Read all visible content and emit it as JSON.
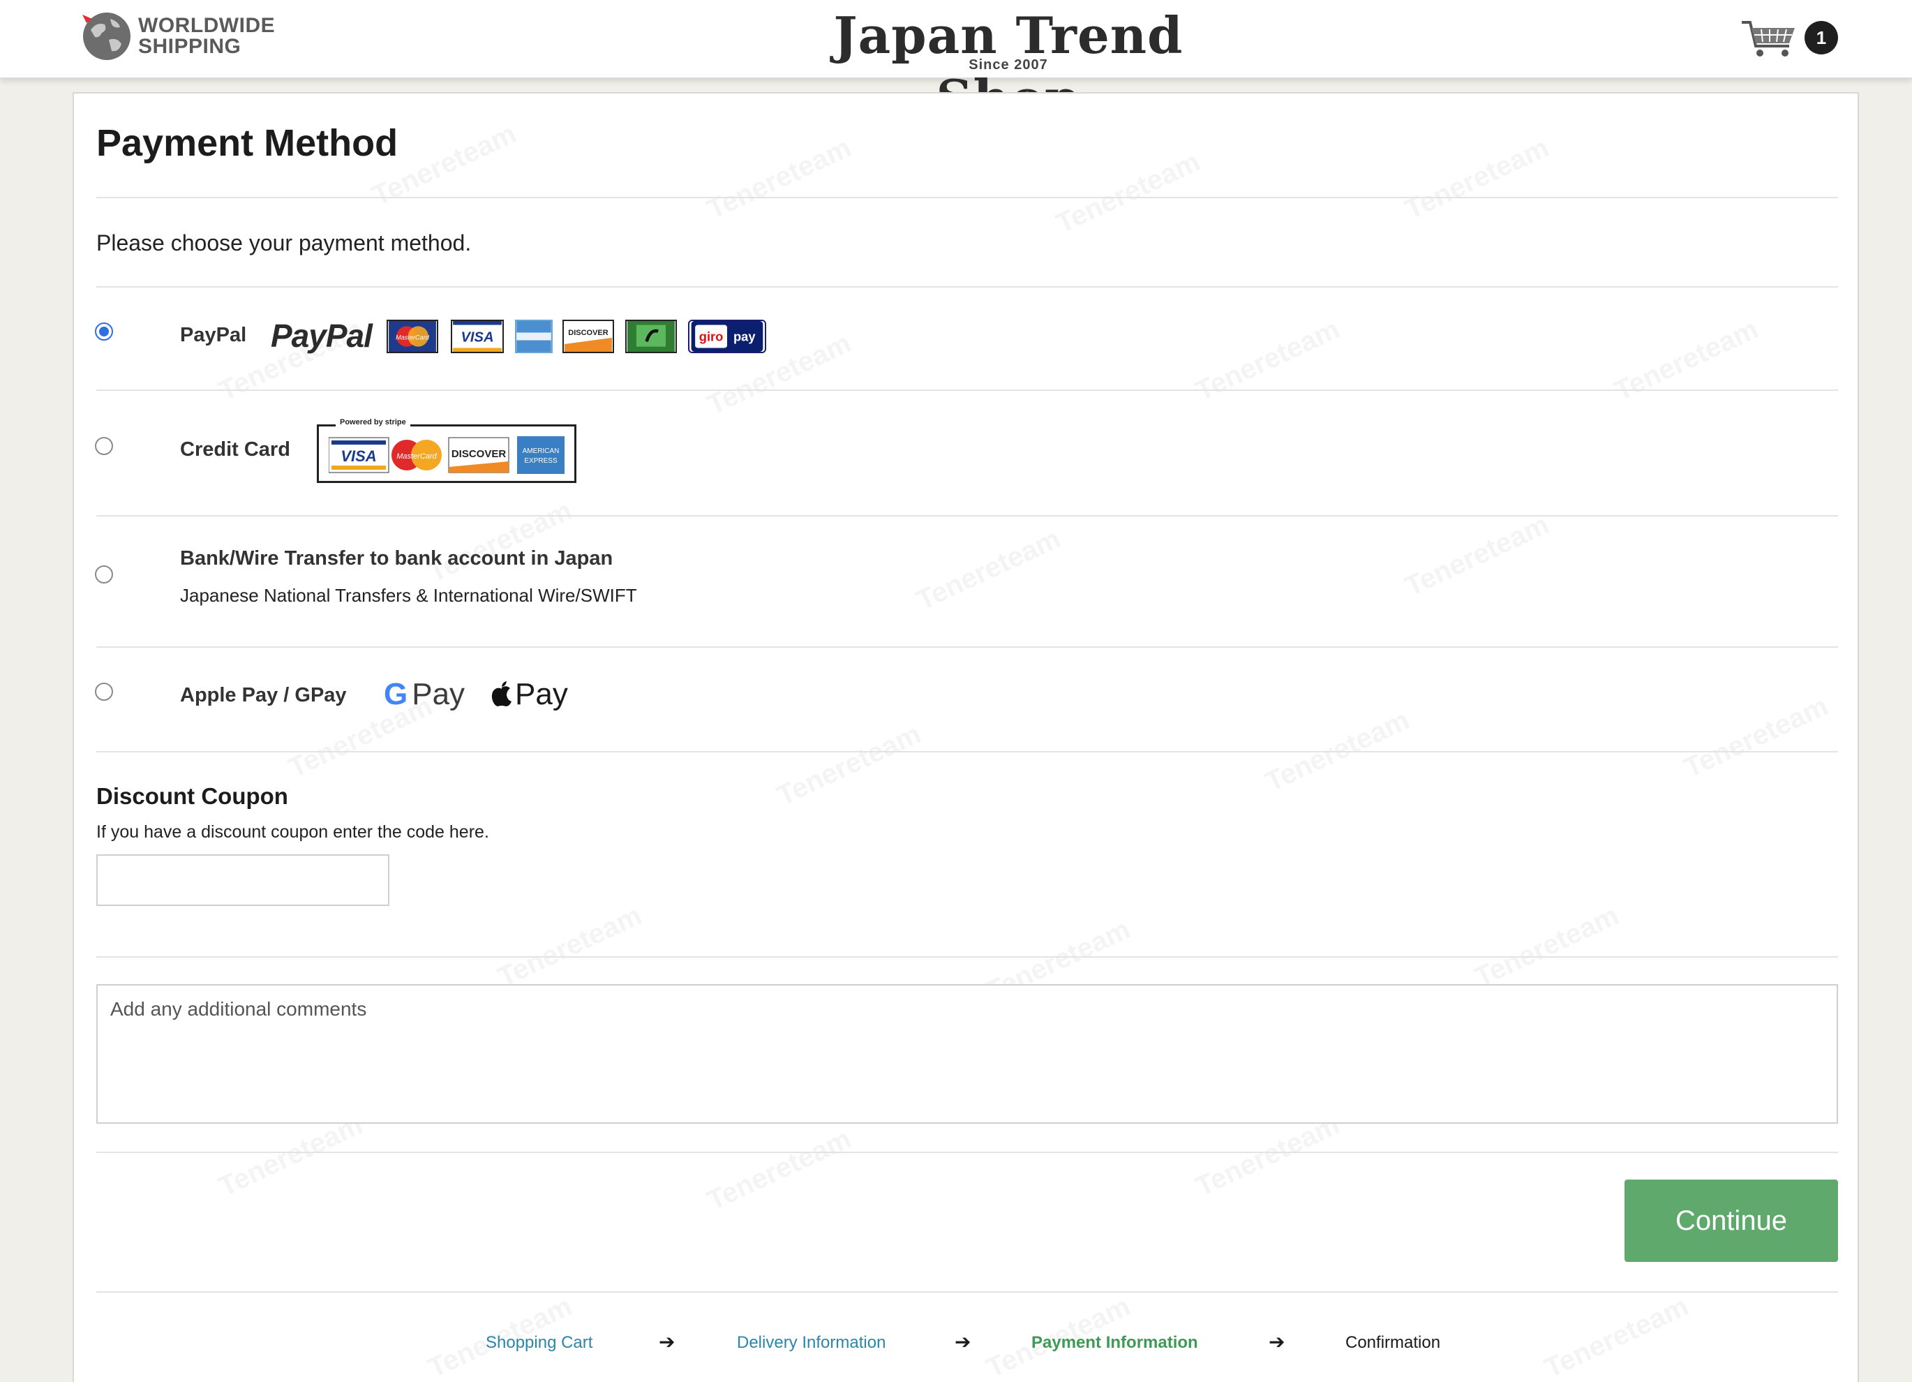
{
  "header": {
    "shipping_logo_line1": "WORLDWIDE",
    "shipping_logo_line2": "SHIPPING",
    "brand_title": "Japan Trend Shop",
    "brand_sub": "Since 2007",
    "cart_count": "1"
  },
  "page": {
    "title": "Payment Method",
    "intro": "Please choose your payment method."
  },
  "payment_options": [
    {
      "label": "PayPal",
      "selected": true,
      "logos": [
        "PayPal",
        "MasterCard",
        "VISA",
        "American Express",
        "DISCOVER",
        "giropay"
      ]
    },
    {
      "label": "Credit Card",
      "selected": false,
      "powered_by": "Powered by stripe",
      "logos": [
        "VISA",
        "MasterCard",
        "DISCOVER",
        "AMERICAN EXPRESS"
      ]
    },
    {
      "label": "Bank/Wire Transfer to bank account in Japan",
      "sub": "Japanese National Transfers & International Wire/SWIFT",
      "selected": false
    },
    {
      "label": "Apple Pay / GPay",
      "selected": false,
      "logos": [
        "G Pay",
        "Pay"
      ]
    }
  ],
  "discount": {
    "title": "Discount Coupon",
    "text": "If you have a discount coupon enter the code here.",
    "value": ""
  },
  "comments": {
    "placeholder": "Add any additional comments"
  },
  "continue_label": "Continue",
  "steps": [
    {
      "label": "Shopping Cart",
      "state": "link"
    },
    {
      "label": "Delivery Information",
      "state": "link"
    },
    {
      "label": "Payment Information",
      "state": "active"
    },
    {
      "label": "Confirmation",
      "state": "plain"
    }
  ],
  "step_arrow": "➔",
  "colors": {
    "accent_green": "#5fa96c",
    "link_blue": "#2b86a8",
    "radio_blue": "#2f6fe0"
  }
}
